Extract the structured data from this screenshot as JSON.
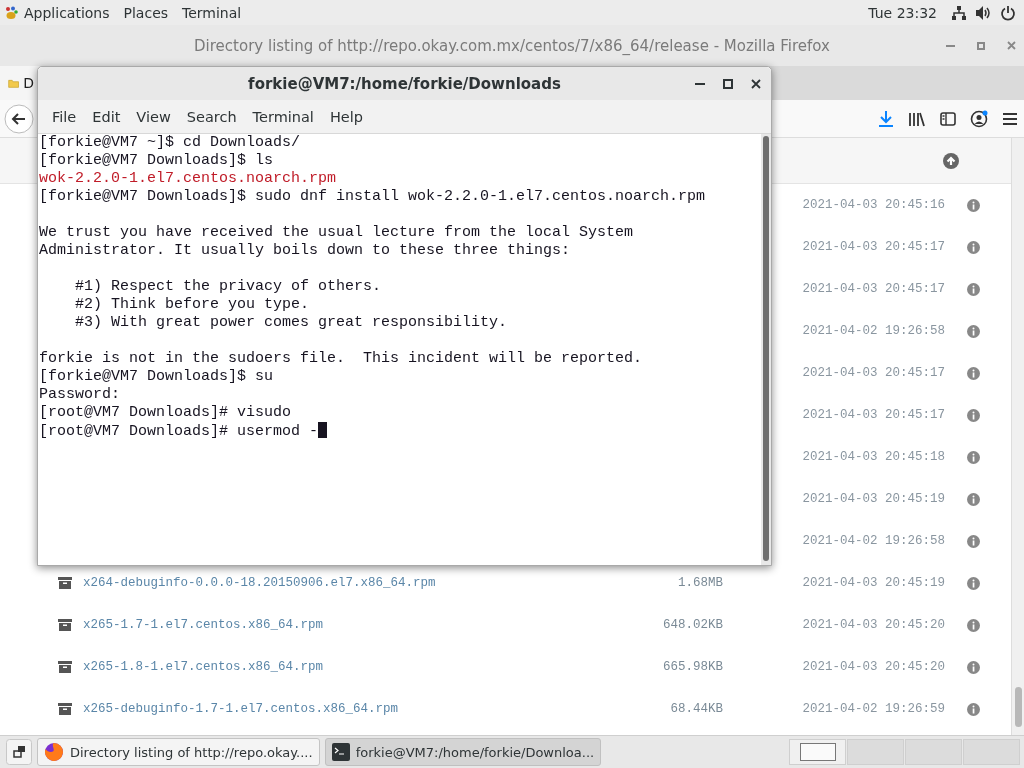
{
  "top_bar": {
    "menus": [
      "Applications",
      "Places",
      "Terminal"
    ],
    "clock": "Tue 23:32"
  },
  "firefox": {
    "title": "Directory listing of http://repo.okay.com.mx/centos/7/x86_64/release - Mozilla Firefox",
    "tab_label": "D",
    "rows": [
      {
        "date": "2021-04-03 20:45:16"
      },
      {
        "date": "2021-04-03 20:45:17"
      },
      {
        "date": "2021-04-03 20:45:17"
      },
      {
        "date": "2021-04-02 19:26:58"
      },
      {
        "date": "2021-04-03 20:45:17"
      },
      {
        "date": "2021-04-03 20:45:17"
      },
      {
        "date": "2021-04-03 20:45:18"
      },
      {
        "date": "2021-04-03 20:45:19"
      },
      {
        "date": "2021-04-02 19:26:58"
      },
      {
        "name": "x264-debuginfo-0.0.0-18.20150906.el7.x86_64.rpm",
        "size": "1.68MB",
        "date": "2021-04-03 20:45:19"
      },
      {
        "name": "x265-1.7-1.el7.centos.x86_64.rpm",
        "size": "648.02KB",
        "date": "2021-04-03 20:45:20"
      },
      {
        "name": "x265-1.8-1.el7.centos.x86_64.rpm",
        "size": "665.98KB",
        "date": "2021-04-03 20:45:20"
      },
      {
        "name": "x265-debuginfo-1.7-1.el7.centos.x86_64.rpm",
        "size": "68.44KB",
        "date": "2021-04-02 19:26:59"
      }
    ]
  },
  "terminal": {
    "title": "forkie@VM7:/home/forkie/Downloads",
    "menu": [
      "File",
      "Edit",
      "View",
      "Search",
      "Terminal",
      "Help"
    ],
    "lines": [
      {
        "kind": "text",
        "text": "[forkie@VM7 ~]$ cd Downloads/"
      },
      {
        "kind": "text",
        "text": "[forkie@VM7 Downloads]$ ls"
      },
      {
        "kind": "file",
        "text": "wok-2.2.0-1.el7.centos.noarch.rpm"
      },
      {
        "kind": "text",
        "text": "[forkie@VM7 Downloads]$ sudo dnf install wok-2.2.0-1.el7.centos.noarch.rpm"
      },
      {
        "kind": "blank"
      },
      {
        "kind": "text",
        "text": "We trust you have received the usual lecture from the local System"
      },
      {
        "kind": "text",
        "text": "Administrator. It usually boils down to these three things:"
      },
      {
        "kind": "blank"
      },
      {
        "kind": "text",
        "text": "    #1) Respect the privacy of others."
      },
      {
        "kind": "text",
        "text": "    #2) Think before you type."
      },
      {
        "kind": "text",
        "text": "    #3) With great power comes great responsibility."
      },
      {
        "kind": "blank"
      },
      {
        "kind": "text",
        "text": "forkie is not in the sudoers file.  This incident will be reported."
      },
      {
        "kind": "text",
        "text": "[forkie@VM7 Downloads]$ su"
      },
      {
        "kind": "text",
        "text": "Password:"
      },
      {
        "kind": "text",
        "text": "[root@VM7 Downloads]# visudo"
      },
      {
        "kind": "text",
        "text": "[root@VM7 Downloads]# usermod -"
      }
    ]
  },
  "taskbar": {
    "items": [
      {
        "kind": "browser",
        "label": "Directory listing of http://repo.okay....",
        "selected": false
      },
      {
        "kind": "terminal",
        "label": "forkie@VM7:/home/forkie/Downloa...",
        "selected": true
      }
    ],
    "workspaces": [
      {
        "selected": true
      },
      {
        "selected": false
      },
      {
        "selected": false
      },
      {
        "selected": false
      }
    ]
  }
}
